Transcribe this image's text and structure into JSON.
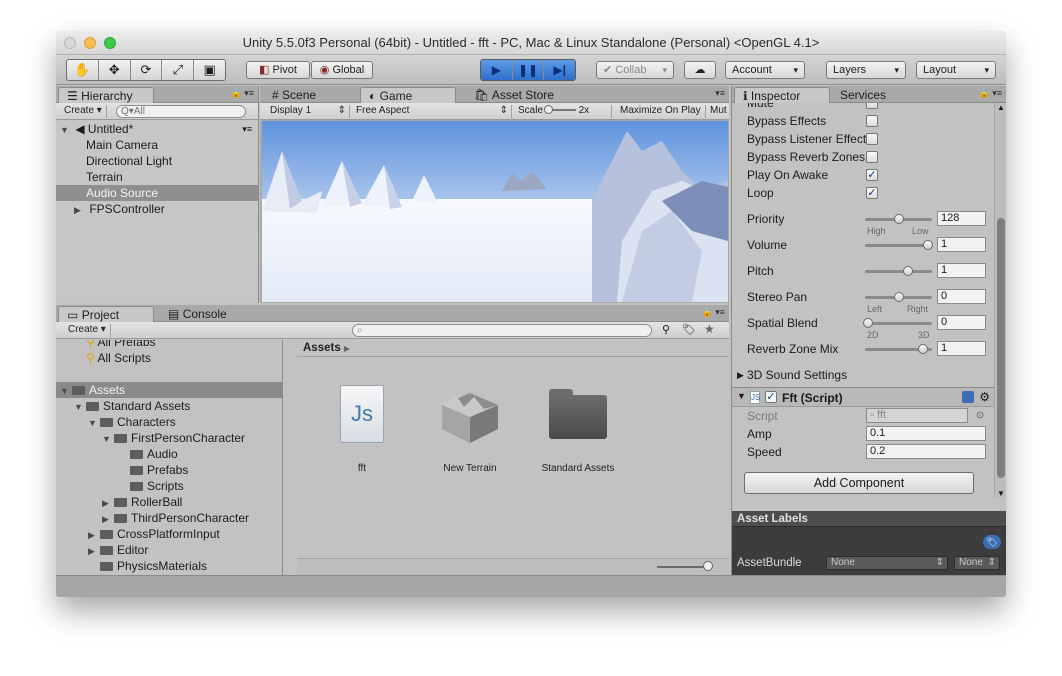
{
  "window": {
    "title": "Unity 5.5.0f3 Personal (64bit) - Untitled - fft - PC, Mac & Linux Standalone (Personal) <OpenGL 4.1>"
  },
  "toolbar": {
    "pivot": "Pivot",
    "global": "Global",
    "collab": "Collab",
    "account": "Account",
    "layers": "Layers",
    "layout": "Layout",
    "play_icon": "play-icon",
    "pause_icon": "pause-icon",
    "step_icon": "step-icon"
  },
  "hierarchy": {
    "tab": "Hierarchy",
    "create": "Create",
    "search_placeholder": "Q▾All",
    "scene": "Untitled*",
    "items": [
      "Main Camera",
      "Directional Light",
      "Terrain",
      "Audio Source",
      "FPSController"
    ],
    "selected": "Audio Source"
  },
  "sceneview": {
    "tabs": [
      "Scene",
      "Game",
      "Asset Store"
    ],
    "active_tab": "Game",
    "display": "Display 1",
    "aspect": "Free Aspect",
    "scale_label": "Scale",
    "scale_value": "2x",
    "maximize": "Maximize On Play",
    "mute": "Mut"
  },
  "project": {
    "tabs": [
      "Project",
      "Console"
    ],
    "create": "Create",
    "tree": [
      {
        "label": "All Prefabs",
        "level": 1,
        "kind": "search"
      },
      {
        "label": "All Scripts",
        "level": 1,
        "kind": "search"
      },
      {
        "label": "Assets",
        "level": 0,
        "kind": "folder",
        "selected": true
      },
      {
        "label": "Standard Assets",
        "level": 1,
        "kind": "folder"
      },
      {
        "label": "Characters",
        "level": 2,
        "kind": "folder"
      },
      {
        "label": "FirstPersonCharacter",
        "level": 3,
        "kind": "folder"
      },
      {
        "label": "Audio",
        "level": 4,
        "kind": "folder"
      },
      {
        "label": "Prefabs",
        "level": 4,
        "kind": "folder"
      },
      {
        "label": "Scripts",
        "level": 4,
        "kind": "folder"
      },
      {
        "label": "RollerBall",
        "level": 3,
        "kind": "folder"
      },
      {
        "label": "ThirdPersonCharacter",
        "level": 3,
        "kind": "folder"
      },
      {
        "label": "CrossPlatformInput",
        "level": 2,
        "kind": "folder"
      },
      {
        "label": "Editor",
        "level": 2,
        "kind": "folder"
      },
      {
        "label": "PhysicsMaterials",
        "level": 2,
        "kind": "folder"
      }
    ],
    "breadcrumb": "Assets",
    "assets": [
      {
        "label": "fft",
        "icon": "js-script-icon"
      },
      {
        "label": "New Terrain",
        "icon": "terrain-icon"
      },
      {
        "label": "Standard Assets",
        "icon": "folder-icon"
      }
    ]
  },
  "inspector": {
    "tabs": [
      "Inspector",
      "Services"
    ],
    "checks": [
      {
        "label": "Mute",
        "checked": false
      },
      {
        "label": "Bypass Effects",
        "checked": false
      },
      {
        "label": "Bypass Listener Effect",
        "checked": false
      },
      {
        "label": "Bypass Reverb Zones",
        "checked": false
      },
      {
        "label": "Play On Awake",
        "checked": true
      },
      {
        "label": "Loop",
        "checked": true
      }
    ],
    "sliders": [
      {
        "label": "Priority",
        "value": "128",
        "fraction": 0.5,
        "min_label": "High",
        "max_label": "Low"
      },
      {
        "label": "Volume",
        "value": "1",
        "fraction": 1.0,
        "min_label": "",
        "max_label": ""
      },
      {
        "label": "Pitch",
        "value": "1",
        "fraction": 0.67,
        "min_label": "",
        "max_label": ""
      },
      {
        "label": "Stereo Pan",
        "value": "0",
        "fraction": 0.5,
        "min_label": "Left",
        "max_label": "Right"
      },
      {
        "label": "Spatial Blend",
        "value": "0",
        "fraction": 0.0,
        "min_label": "2D",
        "max_label": "3D"
      },
      {
        "label": "Reverb Zone Mix",
        "value": "1",
        "fraction": 0.9,
        "min_label": "",
        "max_label": ""
      }
    ],
    "sound_settings": "3D Sound Settings",
    "component": {
      "title": "Fft (Script)",
      "script_label": "Script",
      "script_value": "fft",
      "fields": [
        {
          "label": "Amp",
          "value": "0.1"
        },
        {
          "label": "Speed",
          "value": "0.2"
        }
      ]
    },
    "add_component": "Add Component",
    "asset_labels": "Asset Labels",
    "asset_bundle": "AssetBundle",
    "bundle_name": "None",
    "bundle_variant": "None"
  }
}
